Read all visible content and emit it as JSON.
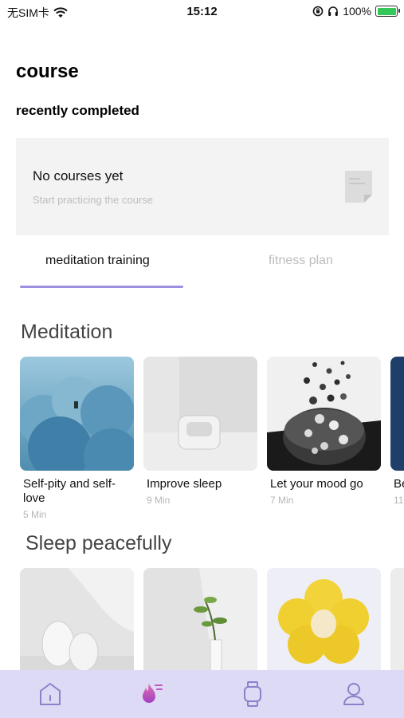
{
  "status_bar": {
    "carrier": "无SIM卡",
    "time": "15:12",
    "battery": "100%",
    "icons": [
      "wifi-icon",
      "orientation-lock-icon",
      "headphones-icon",
      "battery-charging-icon"
    ]
  },
  "page_title": "course",
  "recently_completed": {
    "label": "recently completed",
    "empty_title": "No courses yet",
    "empty_subtitle": "Start practicing the course",
    "icon": "document-icon"
  },
  "tabs": [
    {
      "label": "meditation training",
      "active": true
    },
    {
      "label": "fitness plan",
      "active": false
    }
  ],
  "meditation": {
    "title": "Meditation",
    "courses": [
      {
        "title": "Self-pity and self-love",
        "duration": "5 Min"
      },
      {
        "title": "Improve sleep",
        "duration": "9 Min"
      },
      {
        "title": "Let your mood go",
        "duration": "7 Min"
      },
      {
        "title": "Be",
        "duration": "11"
      }
    ]
  },
  "sleep": {
    "title": "Sleep peacefully"
  },
  "bottom_nav": {
    "items": [
      "home-icon",
      "fire-icon",
      "watch-icon",
      "profile-icon"
    ],
    "active_color": "#c054c0",
    "inactive_color": "#8a82c8"
  },
  "colors": {
    "accent": "#9a8fe0",
    "tab_bar_bg": "#dcdaf5"
  }
}
